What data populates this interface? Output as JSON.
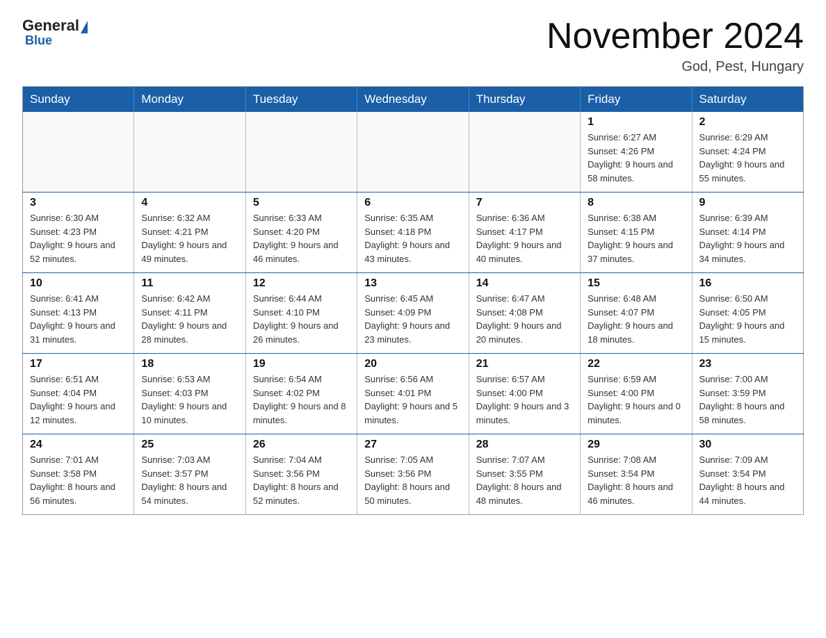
{
  "header": {
    "logo_general": "General",
    "logo_blue": "Blue",
    "title": "November 2024",
    "subtitle": "God, Pest, Hungary"
  },
  "weekdays": [
    "Sunday",
    "Monday",
    "Tuesday",
    "Wednesday",
    "Thursday",
    "Friday",
    "Saturday"
  ],
  "weeks": [
    [
      {
        "day": "",
        "info": ""
      },
      {
        "day": "",
        "info": ""
      },
      {
        "day": "",
        "info": ""
      },
      {
        "day": "",
        "info": ""
      },
      {
        "day": "",
        "info": ""
      },
      {
        "day": "1",
        "info": "Sunrise: 6:27 AM\nSunset: 4:26 PM\nDaylight: 9 hours and 58 minutes."
      },
      {
        "day": "2",
        "info": "Sunrise: 6:29 AM\nSunset: 4:24 PM\nDaylight: 9 hours and 55 minutes."
      }
    ],
    [
      {
        "day": "3",
        "info": "Sunrise: 6:30 AM\nSunset: 4:23 PM\nDaylight: 9 hours and 52 minutes."
      },
      {
        "day": "4",
        "info": "Sunrise: 6:32 AM\nSunset: 4:21 PM\nDaylight: 9 hours and 49 minutes."
      },
      {
        "day": "5",
        "info": "Sunrise: 6:33 AM\nSunset: 4:20 PM\nDaylight: 9 hours and 46 minutes."
      },
      {
        "day": "6",
        "info": "Sunrise: 6:35 AM\nSunset: 4:18 PM\nDaylight: 9 hours and 43 minutes."
      },
      {
        "day": "7",
        "info": "Sunrise: 6:36 AM\nSunset: 4:17 PM\nDaylight: 9 hours and 40 minutes."
      },
      {
        "day": "8",
        "info": "Sunrise: 6:38 AM\nSunset: 4:15 PM\nDaylight: 9 hours and 37 minutes."
      },
      {
        "day": "9",
        "info": "Sunrise: 6:39 AM\nSunset: 4:14 PM\nDaylight: 9 hours and 34 minutes."
      }
    ],
    [
      {
        "day": "10",
        "info": "Sunrise: 6:41 AM\nSunset: 4:13 PM\nDaylight: 9 hours and 31 minutes."
      },
      {
        "day": "11",
        "info": "Sunrise: 6:42 AM\nSunset: 4:11 PM\nDaylight: 9 hours and 28 minutes."
      },
      {
        "day": "12",
        "info": "Sunrise: 6:44 AM\nSunset: 4:10 PM\nDaylight: 9 hours and 26 minutes."
      },
      {
        "day": "13",
        "info": "Sunrise: 6:45 AM\nSunset: 4:09 PM\nDaylight: 9 hours and 23 minutes."
      },
      {
        "day": "14",
        "info": "Sunrise: 6:47 AM\nSunset: 4:08 PM\nDaylight: 9 hours and 20 minutes."
      },
      {
        "day": "15",
        "info": "Sunrise: 6:48 AM\nSunset: 4:07 PM\nDaylight: 9 hours and 18 minutes."
      },
      {
        "day": "16",
        "info": "Sunrise: 6:50 AM\nSunset: 4:05 PM\nDaylight: 9 hours and 15 minutes."
      }
    ],
    [
      {
        "day": "17",
        "info": "Sunrise: 6:51 AM\nSunset: 4:04 PM\nDaylight: 9 hours and 12 minutes."
      },
      {
        "day": "18",
        "info": "Sunrise: 6:53 AM\nSunset: 4:03 PM\nDaylight: 9 hours and 10 minutes."
      },
      {
        "day": "19",
        "info": "Sunrise: 6:54 AM\nSunset: 4:02 PM\nDaylight: 9 hours and 8 minutes."
      },
      {
        "day": "20",
        "info": "Sunrise: 6:56 AM\nSunset: 4:01 PM\nDaylight: 9 hours and 5 minutes."
      },
      {
        "day": "21",
        "info": "Sunrise: 6:57 AM\nSunset: 4:00 PM\nDaylight: 9 hours and 3 minutes."
      },
      {
        "day": "22",
        "info": "Sunrise: 6:59 AM\nSunset: 4:00 PM\nDaylight: 9 hours and 0 minutes."
      },
      {
        "day": "23",
        "info": "Sunrise: 7:00 AM\nSunset: 3:59 PM\nDaylight: 8 hours and 58 minutes."
      }
    ],
    [
      {
        "day": "24",
        "info": "Sunrise: 7:01 AM\nSunset: 3:58 PM\nDaylight: 8 hours and 56 minutes."
      },
      {
        "day": "25",
        "info": "Sunrise: 7:03 AM\nSunset: 3:57 PM\nDaylight: 8 hours and 54 minutes."
      },
      {
        "day": "26",
        "info": "Sunrise: 7:04 AM\nSunset: 3:56 PM\nDaylight: 8 hours and 52 minutes."
      },
      {
        "day": "27",
        "info": "Sunrise: 7:05 AM\nSunset: 3:56 PM\nDaylight: 8 hours and 50 minutes."
      },
      {
        "day": "28",
        "info": "Sunrise: 7:07 AM\nSunset: 3:55 PM\nDaylight: 8 hours and 48 minutes."
      },
      {
        "day": "29",
        "info": "Sunrise: 7:08 AM\nSunset: 3:54 PM\nDaylight: 8 hours and 46 minutes."
      },
      {
        "day": "30",
        "info": "Sunrise: 7:09 AM\nSunset: 3:54 PM\nDaylight: 8 hours and 44 minutes."
      }
    ]
  ]
}
